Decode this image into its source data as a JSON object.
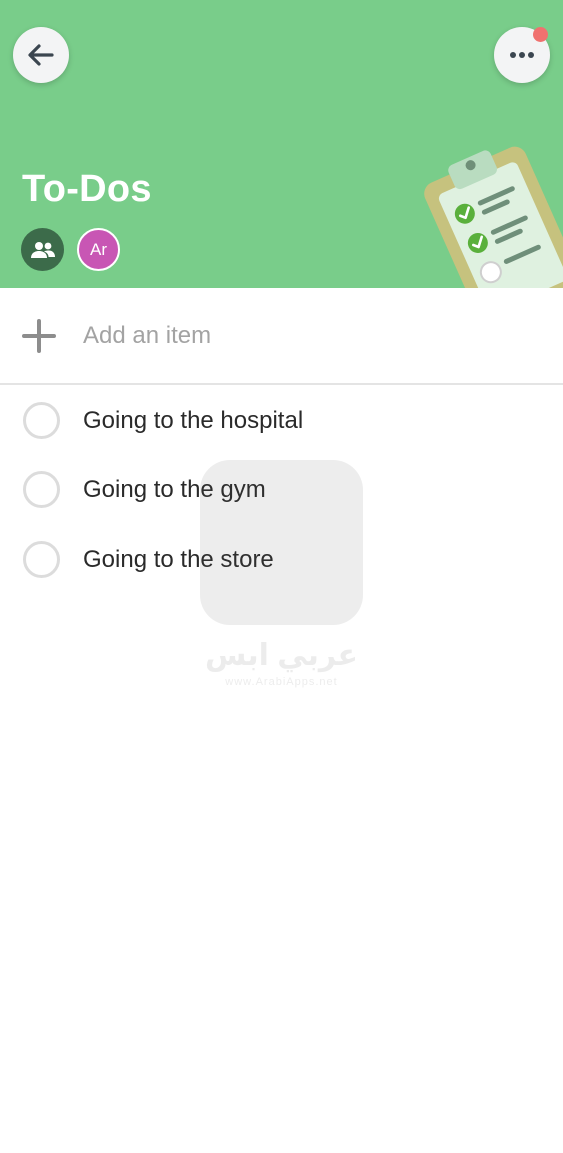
{
  "header": {
    "title": "To-Dos",
    "background_color": "#79cd8a",
    "back_icon": "back-arrow-icon",
    "more_icon": "more-horizontal-icon",
    "notification_color": "#f0716f"
  },
  "members": {
    "group_icon": "people-icon",
    "avatar_initials": "Ar",
    "avatar_color": "#c856b4"
  },
  "add_item": {
    "icon": "plus-icon",
    "placeholder": "Add an item"
  },
  "tasks": [
    {
      "label": "Going to the hospital",
      "completed": false
    },
    {
      "label": "Going to the gym",
      "completed": false
    },
    {
      "label": "Going to the store",
      "completed": false
    }
  ],
  "watermark": {
    "arabic": "عربي ابس",
    "url": "www.ArabiApps.net"
  }
}
